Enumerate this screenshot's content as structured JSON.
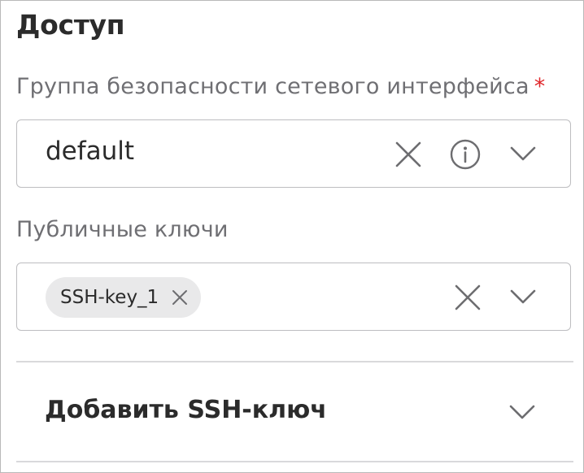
{
  "access": {
    "title": "Доступ",
    "security_group": {
      "label": "Группа безопасности сетевого интерфейса",
      "required_mark": "*",
      "value": "default"
    },
    "public_keys": {
      "label": "Публичные ключи",
      "selected": [
        "SSH-key_1"
      ]
    },
    "add_ssh_key": {
      "label": "Добавить SSH-ключ"
    }
  },
  "colors": {
    "required": "#e0262a",
    "text": "#2b2b2b",
    "label": "#6f6f73",
    "border": "#bdbdc0",
    "chip_bg": "#e9e9ea",
    "icon": "#6d6d70"
  },
  "icons": {
    "clear": "close-icon",
    "info": "info-icon",
    "expand": "chevron-down-icon"
  }
}
